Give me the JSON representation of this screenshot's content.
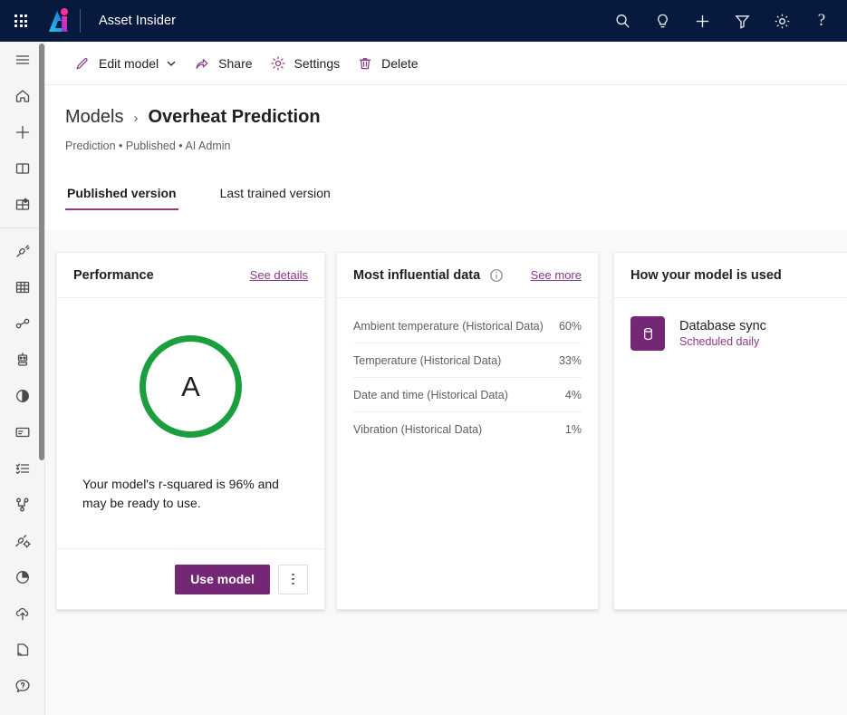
{
  "suite": {
    "waffle_label": "app-launcher",
    "brand_label": "brand-logo",
    "app_title": "Asset Insider",
    "icons": [
      {
        "name": "search-icon",
        "label": "Search"
      },
      {
        "name": "lightbulb-icon",
        "label": "Ideas"
      },
      {
        "name": "plus-icon",
        "label": "New"
      },
      {
        "name": "filter-icon",
        "label": "Filter"
      },
      {
        "name": "gear-icon",
        "label": "Settings"
      },
      {
        "name": "help-icon",
        "label": "?"
      }
    ]
  },
  "rail": {
    "items": [
      {
        "name": "hamburger-icon",
        "label": "Menu"
      },
      {
        "name": "home-icon",
        "label": "Home"
      },
      {
        "name": "plus-icon",
        "label": "Create"
      },
      {
        "name": "book-icon",
        "label": "Learn"
      },
      {
        "name": "apps-icon",
        "label": "Apps"
      },
      {
        "name": "connector-icon",
        "label": "Connectors"
      },
      {
        "name": "table-icon",
        "label": "Tables"
      },
      {
        "name": "dataflow-icon",
        "label": "Dataflows"
      },
      {
        "name": "bot-icon",
        "label": "Chatbots"
      },
      {
        "name": "ai-brain-icon",
        "label": "AI Builder"
      },
      {
        "name": "card-icon",
        "label": "Cards"
      },
      {
        "name": "checklist-icon",
        "label": "Solutions"
      },
      {
        "name": "branch-icon",
        "label": "Flows"
      },
      {
        "name": "plug-gear-icon",
        "label": "Gateways"
      },
      {
        "name": "pie-chart-icon",
        "label": "Analytics"
      },
      {
        "name": "cloud-upload-icon",
        "label": "Export"
      },
      {
        "name": "document-icon",
        "label": "Documents"
      },
      {
        "name": "help-chat-icon",
        "label": "Help"
      }
    ]
  },
  "toolbar": {
    "edit_model_label": "Edit model",
    "share_label": "Share",
    "settings_label": "Settings",
    "delete_label": "Delete"
  },
  "header": {
    "breadcrumb_parent": "Models",
    "breadcrumb_separator": "›",
    "breadcrumb_current": "Overheat Prediction",
    "subline": "Prediction • Published • AI Admin"
  },
  "tabs": [
    {
      "label": "Published version",
      "active": true
    },
    {
      "label": "Last trained version",
      "active": false
    }
  ],
  "performance_card": {
    "title": "Performance",
    "link_label": "See details",
    "grade": "A",
    "grade_color": "#1a9e3e",
    "summary": "Your model's r-squared is 96% and may be ready to use.",
    "primary_button": "Use model",
    "more_button_label": "More options"
  },
  "influential_card": {
    "title": "Most influential data",
    "link_label": "See more",
    "rows": [
      {
        "name": "Ambient temperature (Historical Data)",
        "value": "60%"
      },
      {
        "name": "Temperature (Historical Data)",
        "value": "33%"
      },
      {
        "name": "Date and time (Historical Data)",
        "value": "4%"
      },
      {
        "name": "Vibration (Historical Data)",
        "value": "1%"
      }
    ]
  },
  "usage_card": {
    "title": "How your model is used",
    "item_name": "Database sync",
    "item_sub": "Scheduled daily"
  },
  "colors": {
    "suite_bar": "#071A3D",
    "accent_purple": "#742774",
    "link_purple": "#8a3a86",
    "grade_green": "#1a9e3e",
    "page_bg": "#faf9f8"
  }
}
